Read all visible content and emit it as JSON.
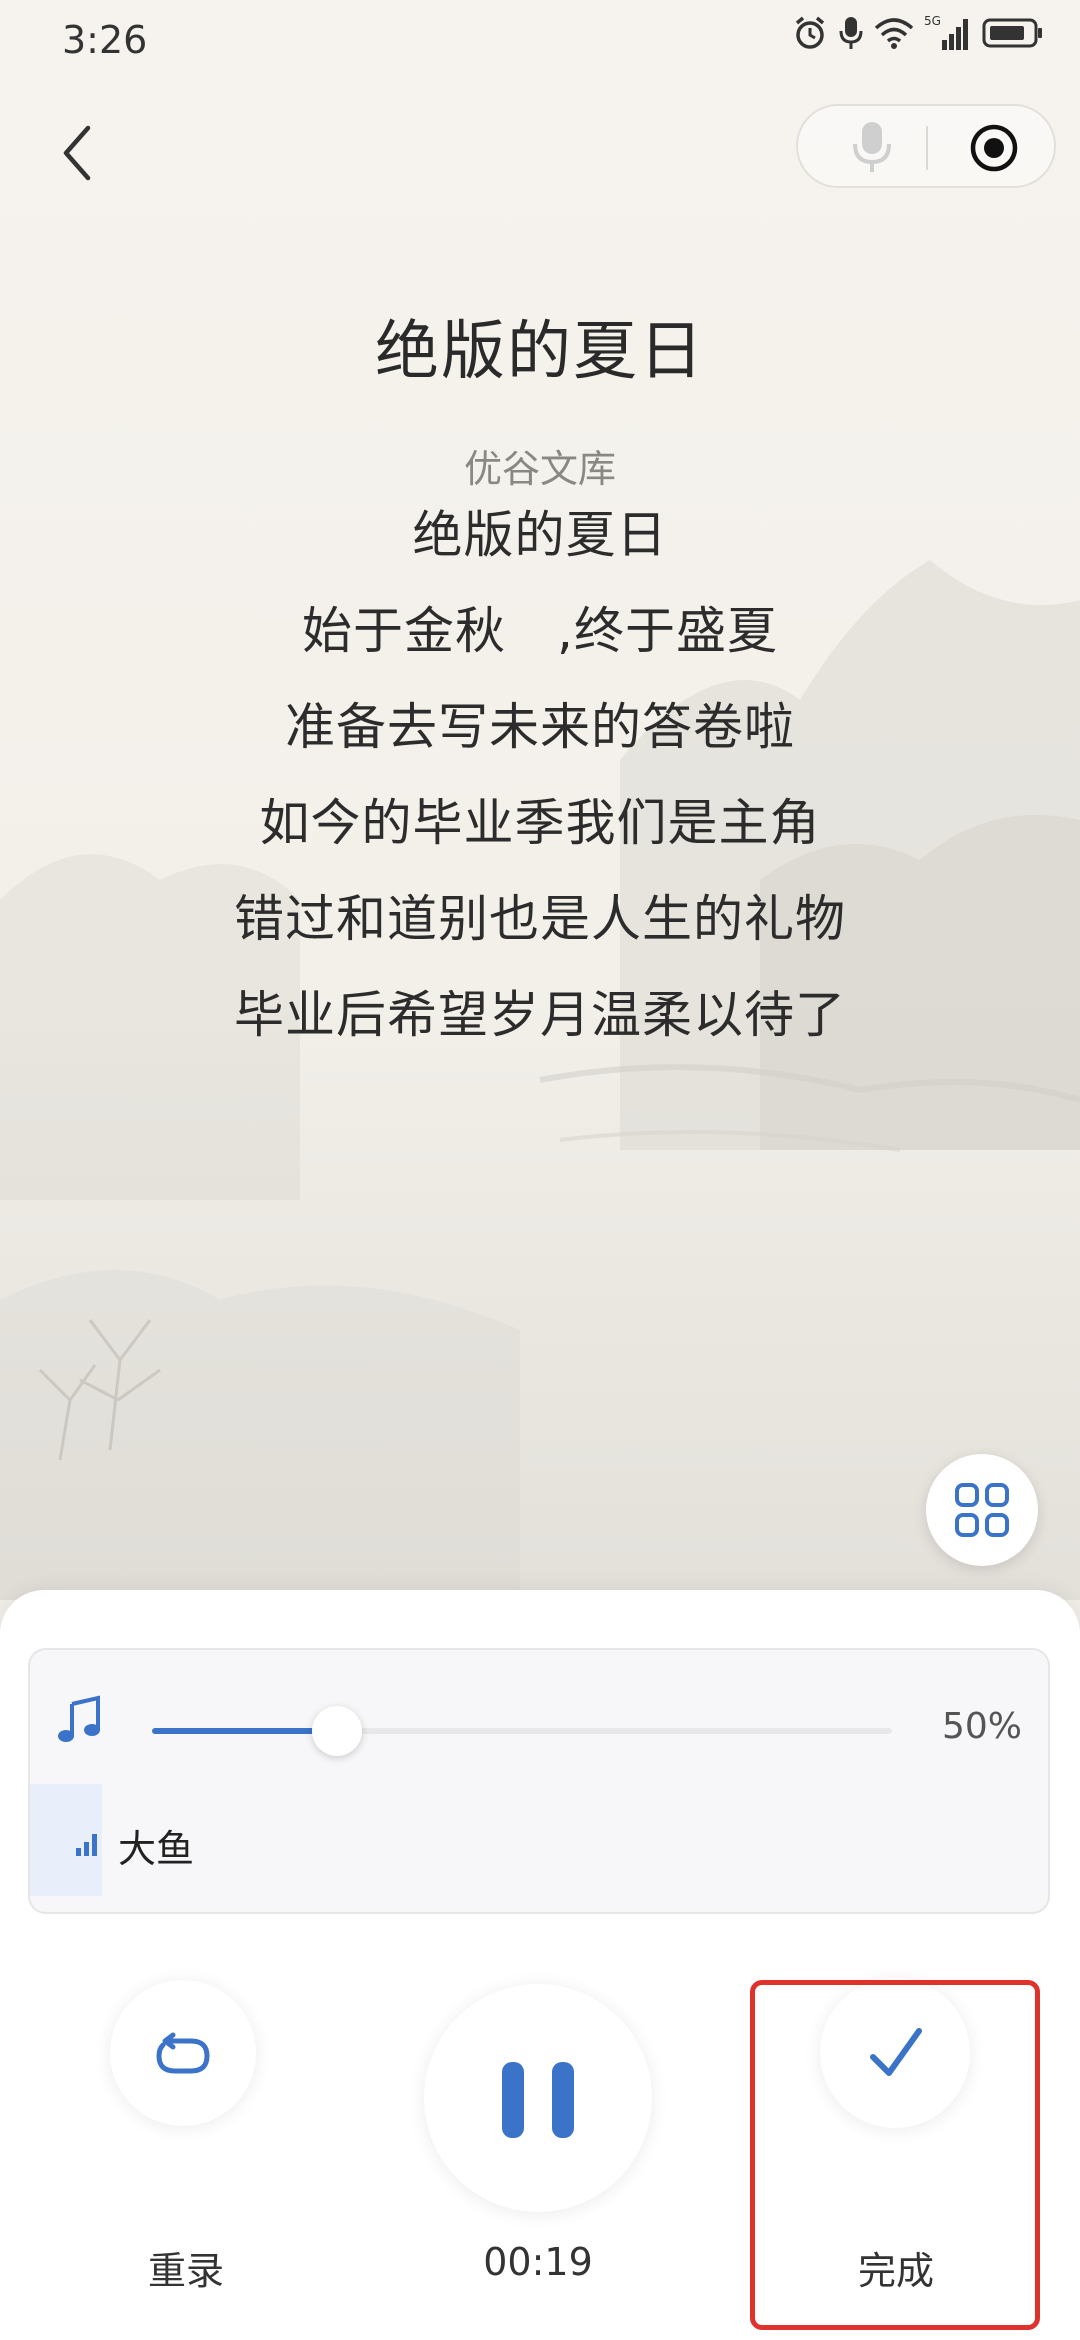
{
  "status_bar": {
    "time": "3:26",
    "network": "5G",
    "icons": [
      "alarm-icon",
      "mic-icon",
      "wifi-icon",
      "signal-icon",
      "battery-icon"
    ]
  },
  "nav": {
    "back_icon": "chevron-left-icon",
    "capsule_icons": [
      "mic-icon",
      "target-icon"
    ]
  },
  "content": {
    "title": "绝版的夏日",
    "source": "优谷文库",
    "lines": [
      "绝版的夏日",
      "始于金秋　,终于盛夏",
      "准备去写未来的答卷啦",
      "如今的毕业季我们是主角",
      "错过和道别也是人生的礼物",
      "毕业后希望岁月温柔以待了"
    ]
  },
  "floating": {
    "grid_icon": "grid-icon"
  },
  "music": {
    "icon": "music-note-icon",
    "volume_percent": 50,
    "volume_label": "50%",
    "track_name": "大鱼",
    "track_indicator_icon": "signal-bars-icon"
  },
  "controls": {
    "rerecord_label": "重录",
    "timer": "00:19",
    "done_label": "完成",
    "icons": [
      "refresh-icon",
      "pause-icon",
      "check-icon"
    ]
  },
  "colors": {
    "accent": "#3b73c9",
    "highlight": "#e0322d",
    "background": "#f4f1ec"
  }
}
